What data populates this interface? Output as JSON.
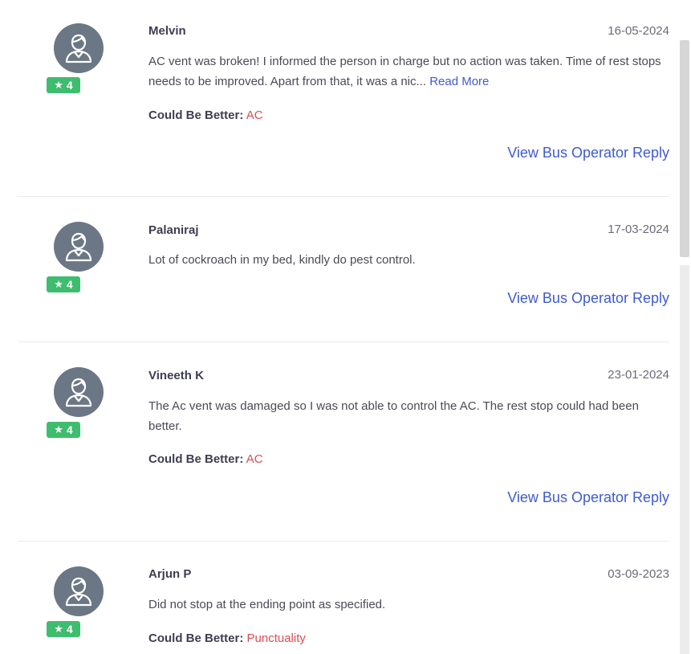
{
  "reviews": [
    {
      "name": "Melvin",
      "date": "16-05-2024",
      "rating": "4",
      "text": "AC vent was broken! I informed the person in charge but no action was taken. Time of rest stops needs to be improved. Apart from that, it was a nic...",
      "read_more": "Read More",
      "could_be_better_label": "Could Be Better:",
      "could_be_better": "AC",
      "reply_label": "View Bus Operator Reply"
    },
    {
      "name": "Palaniraj",
      "date": "17-03-2024",
      "rating": "4",
      "text": "Lot of cockroach in my bed, kindly do pest control.",
      "reply_label": "View Bus Operator Reply"
    },
    {
      "name": "Vineeth K",
      "date": "23-01-2024",
      "rating": "4",
      "text": "The Ac vent was damaged so I was not able to control the AC. The rest stop could had been better.",
      "could_be_better_label": "Could Be Better:",
      "could_be_better": "AC",
      "reply_label": "View Bus Operator Reply"
    },
    {
      "name": "Arjun P",
      "date": "03-09-2023",
      "rating": "4",
      "text": "Did not stop at the ending point as specified.",
      "could_be_better_label": "Could Be Better:",
      "could_be_better": "Punctuality"
    }
  ],
  "icons": {
    "avatar": "user-avatar-icon",
    "star": "star-icon"
  },
  "colors": {
    "rating_badge": "#3ebd6e",
    "link": "#3f5bd0",
    "could_be_better_tag": "#d84e55",
    "avatar_bg": "#6b7784"
  }
}
